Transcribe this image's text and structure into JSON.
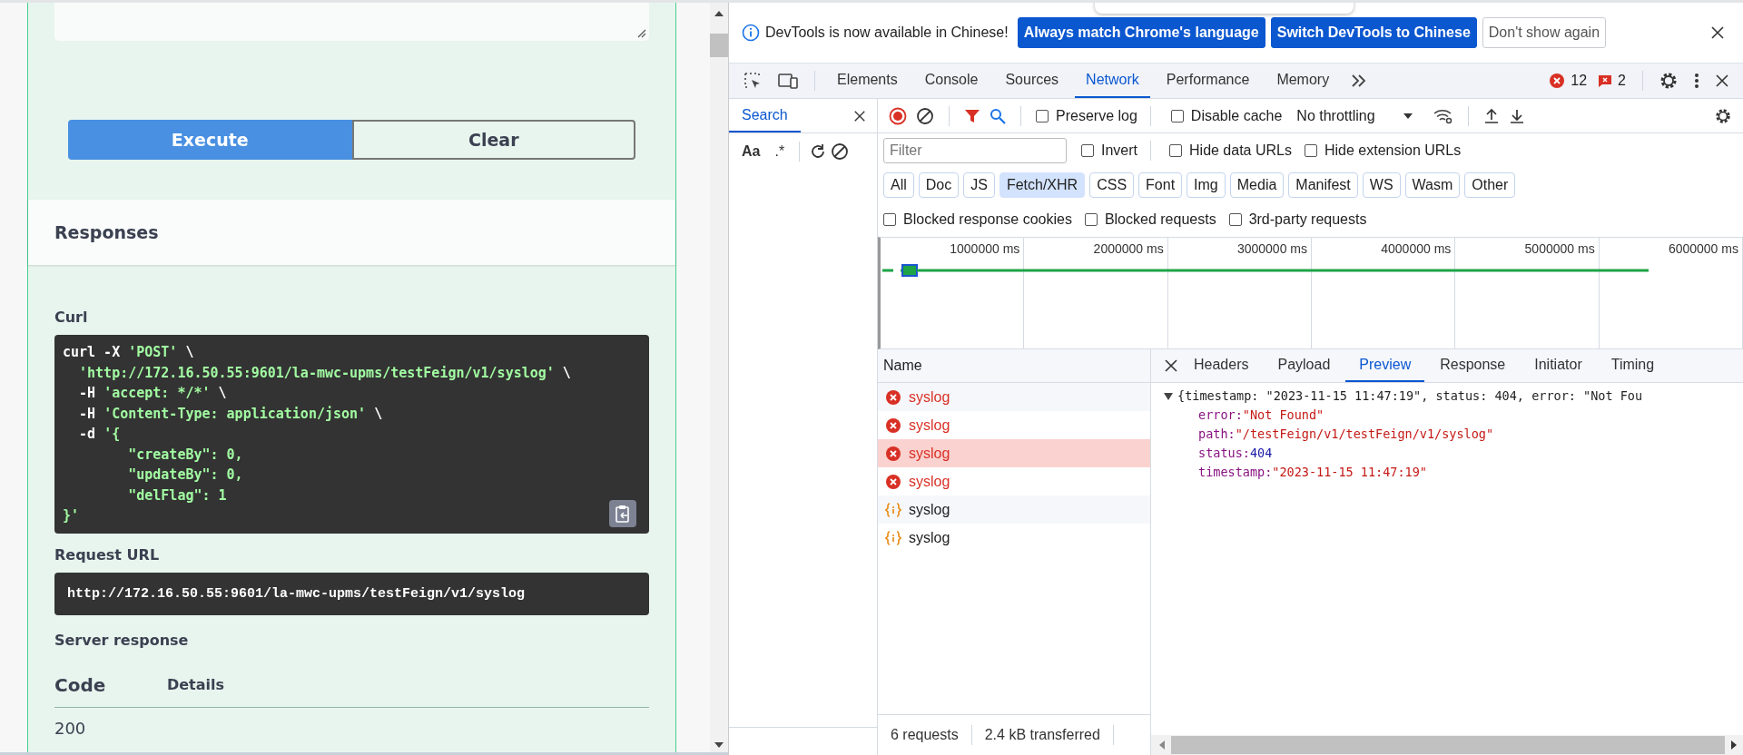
{
  "page": {
    "buttons": [
      {
        "label": "Execute",
        "kind": "primary"
      },
      {
        "label": "Clear",
        "kind": "secondary"
      }
    ],
    "responses_title": "Responses",
    "curl_label": "Curl",
    "curl_lines": [
      [
        {
          "text": "curl -X ",
          "kind": "plain"
        },
        {
          "text": "'POST'",
          "kind": "string"
        },
        {
          "text": " \\",
          "kind": "plain"
        }
      ],
      [
        {
          "text": "  'http://172.16.50.55:9601/la-mwc-upms/testFeign/v1/syslog'",
          "kind": "string"
        },
        {
          "text": " \\",
          "kind": "plain"
        }
      ],
      [
        {
          "text": "  -H ",
          "kind": "plain"
        },
        {
          "text": "'accept: */*'",
          "kind": "string"
        },
        {
          "text": " \\",
          "kind": "plain"
        }
      ],
      [
        {
          "text": "  -H ",
          "kind": "plain"
        },
        {
          "text": "'Content-Type: application/json'",
          "kind": "string"
        },
        {
          "text": " \\",
          "kind": "plain"
        }
      ],
      [
        {
          "text": "  -d ",
          "kind": "plain"
        },
        {
          "text": "'{",
          "kind": "string"
        }
      ],
      [
        {
          "text": "        \"createBy\": 0,",
          "kind": "string"
        }
      ],
      [
        {
          "text": "        \"updateBy\": 0,",
          "kind": "string"
        }
      ],
      [
        {
          "text": "        \"delFlag\": 1",
          "kind": "string"
        }
      ],
      [
        {
          "text": "}'",
          "kind": "string"
        }
      ]
    ],
    "request_url_label": "Request URL",
    "request_url": "http://172.16.50.55:9601/la-mwc-upms/testFeign/v1/syslog",
    "server_response_label": "Server response",
    "columns": [
      "Code",
      "Details"
    ],
    "code": "200"
  },
  "devtools": {
    "banner": {
      "message": "DevTools is now available in Chinese!",
      "buttons": [
        {
          "label": "Always match Chrome's language",
          "kind": "primary"
        },
        {
          "label": "Switch DevTools to Chinese",
          "kind": "primary"
        },
        {
          "label": "Don't show again",
          "kind": "secondary"
        }
      ]
    },
    "tabs": [
      {
        "label": "Elements",
        "selected": false
      },
      {
        "label": "Console",
        "selected": false
      },
      {
        "label": "Sources",
        "selected": false
      },
      {
        "label": "Network",
        "selected": true
      },
      {
        "label": "Performance",
        "selected": false
      },
      {
        "label": "Memory",
        "selected": false
      }
    ],
    "error_count": "12",
    "issue_count": "2",
    "search_tab": "Search",
    "search_toggles": [
      "Aa",
      ".*"
    ],
    "toolbar_checkboxes": [
      {
        "label": "Preserve log",
        "checked": false
      },
      {
        "label": "Disable cache",
        "checked": false
      }
    ],
    "throttling": "No throttling",
    "filter": {
      "placeholder": "Filter"
    },
    "filter_checkboxes": [
      {
        "label": "Invert",
        "checked": false
      },
      {
        "label": "Hide data URLs",
        "checked": false
      },
      {
        "label": "Hide extension URLs",
        "checked": false
      }
    ],
    "type_filters": [
      {
        "label": "All",
        "selected": false
      },
      {
        "label": "Doc",
        "selected": false
      },
      {
        "label": "JS",
        "selected": false
      },
      {
        "label": "Fetch/XHR",
        "selected": true
      },
      {
        "label": "CSS",
        "selected": false
      },
      {
        "label": "Font",
        "selected": false
      },
      {
        "label": "Img",
        "selected": false
      },
      {
        "label": "Media",
        "selected": false
      },
      {
        "label": "Manifest",
        "selected": false
      },
      {
        "label": "WS",
        "selected": false
      },
      {
        "label": "Wasm",
        "selected": false
      },
      {
        "label": "Other",
        "selected": false
      }
    ],
    "extra_checkboxes": [
      {
        "label": "Blocked response cookies",
        "checked": false
      },
      {
        "label": "Blocked requests",
        "checked": false
      },
      {
        "label": "3rd-party requests",
        "checked": false
      }
    ],
    "overview_ticks": [
      "1000000 ms",
      "2000000 ms",
      "3000000 ms",
      "4000000 ms",
      "5000000 ms",
      "6000000 ms"
    ],
    "requests": {
      "column": "Name",
      "rows": [
        {
          "name": "syslog",
          "kind": "error",
          "selected": false
        },
        {
          "name": "syslog",
          "kind": "error",
          "selected": false
        },
        {
          "name": "syslog",
          "kind": "error",
          "selected": true
        },
        {
          "name": "syslog",
          "kind": "error",
          "selected": false
        },
        {
          "name": "syslog",
          "kind": "fetch",
          "selected": false
        },
        {
          "name": "syslog",
          "kind": "fetch",
          "selected": false
        }
      ]
    },
    "detail_tabs": [
      {
        "label": "Headers",
        "selected": false
      },
      {
        "label": "Payload",
        "selected": false
      },
      {
        "label": "Preview",
        "selected": true
      },
      {
        "label": "Response",
        "selected": false
      },
      {
        "label": "Initiator",
        "selected": false
      },
      {
        "label": "Timing",
        "selected": false
      }
    ],
    "preview": {
      "summary": "{timestamp: \"2023-11-15 11:47:19\", status: 404, error: \"Not Fou",
      "expanded": true,
      "fields": [
        {
          "key": "error:",
          "value": "\"Not Found\"",
          "kind": "string"
        },
        {
          "key": "path:",
          "value": "\"/testFeign/v1/testFeign/v1/syslog\"",
          "kind": "string"
        },
        {
          "key": "status:",
          "value": "404",
          "kind": "number"
        },
        {
          "key": "timestamp:",
          "value": "\"2023-11-15 11:47:19\"",
          "kind": "string"
        }
      ]
    },
    "status": [
      "6 requests",
      "2.4 kB transferred"
    ]
  }
}
